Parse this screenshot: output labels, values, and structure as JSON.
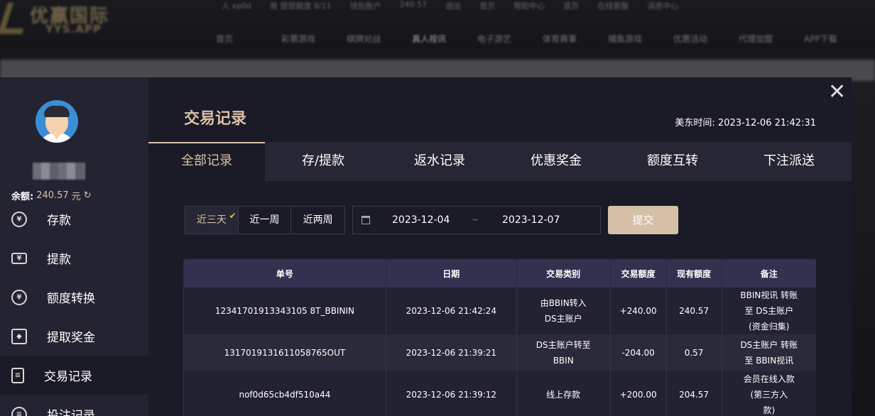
{
  "background": {
    "logo_name": "优赢国际",
    "logo_sub": "YYS.APP",
    "top_bar": [
      "人 xp0d",
      "我 提现额度 8/11",
      "钱包账户",
      "240.57",
      "退出",
      "首页",
      "帮助中心",
      "首页",
      "在线客服",
      "消息中心"
    ],
    "nav": [
      "首页",
      "彩票游戏",
      "棋牌对战",
      "真人视讯",
      "电子游艺",
      "体育赛事",
      "捕鱼游戏",
      "优惠活动",
      "代理加盟",
      "APP下载"
    ],
    "nav_active_index": 3
  },
  "close_label": "✕",
  "sidebar": {
    "balance_label": "余额:",
    "balance_value": "240.57",
    "balance_unit": "元",
    "refresh_glyph": "↻",
    "items": [
      {
        "label": "存款",
        "icon": "deposit-icon",
        "glyph": "¥"
      },
      {
        "label": "提款",
        "icon": "withdraw-ticket-icon",
        "glyph": "¥"
      },
      {
        "label": "额度转换",
        "icon": "transfer-icon",
        "glyph": "¥"
      },
      {
        "label": "提取奖金",
        "icon": "gift-icon",
        "glyph": "◆"
      },
      {
        "label": "交易记录",
        "icon": "clipboard-icon",
        "glyph": "≡"
      },
      {
        "label": "投注记录",
        "icon": "bet-record-icon",
        "glyph": "≡"
      }
    ],
    "active_index": 4
  },
  "main": {
    "title": "交易记录",
    "clock_label": "美东时间:",
    "clock_value": "2023-12-06 21:42:31",
    "tabs": [
      "全部记录",
      "存/提款",
      "返水记录",
      "优惠奖金",
      "额度互转",
      "下注派送"
    ],
    "active_tab": 0,
    "ranges": [
      "近三天",
      "近一周",
      "近两周"
    ],
    "active_range": 0,
    "date_start": "2023-12-04",
    "date_sep": "~",
    "date_end": "2023-12-07",
    "submit_label": "提交"
  },
  "table": {
    "headers": [
      "单号",
      "日期",
      "交易类别",
      "交易额度",
      "现有额度",
      "备注"
    ],
    "rows": [
      {
        "id": "12341701913343105 8T_BBININ",
        "date": "2023-12-06 21:42:24",
        "type_l1": "由BBIN转入",
        "type_l2": "DS主账户",
        "amount": "+240.00",
        "balance": "240.57",
        "note_l1": "BBIN视讯 转账",
        "note_l2": "至 DS主账户",
        "note_l3": "(资金归集)"
      },
      {
        "id": "1317019131611058765OUT",
        "date": "2023-12-06 21:39:21",
        "type_l1": "DS主账户转至",
        "type_l2": "BBIN",
        "amount": "-204.00",
        "balance": "0.57",
        "note_l1": "DS主账户 转账",
        "note_l2": "至 BBIN视讯",
        "note_l3": ""
      },
      {
        "id": "nof0d65cb4df510a44",
        "date": "2023-12-06 21:39:12",
        "type_l1": "线上存款",
        "type_l2": "",
        "amount": "+200.00",
        "balance": "204.57",
        "note_l1": "会员在线入款",
        "note_l2": "(第三方入",
        "note_l3": "款)"
      }
    ]
  },
  "colors": {
    "accent": "#d9c0a8",
    "positive": "#4fc241",
    "negative": "#d42a3c",
    "modal_bg": "#1b1b27",
    "sidebar_bg": "#232332"
  }
}
